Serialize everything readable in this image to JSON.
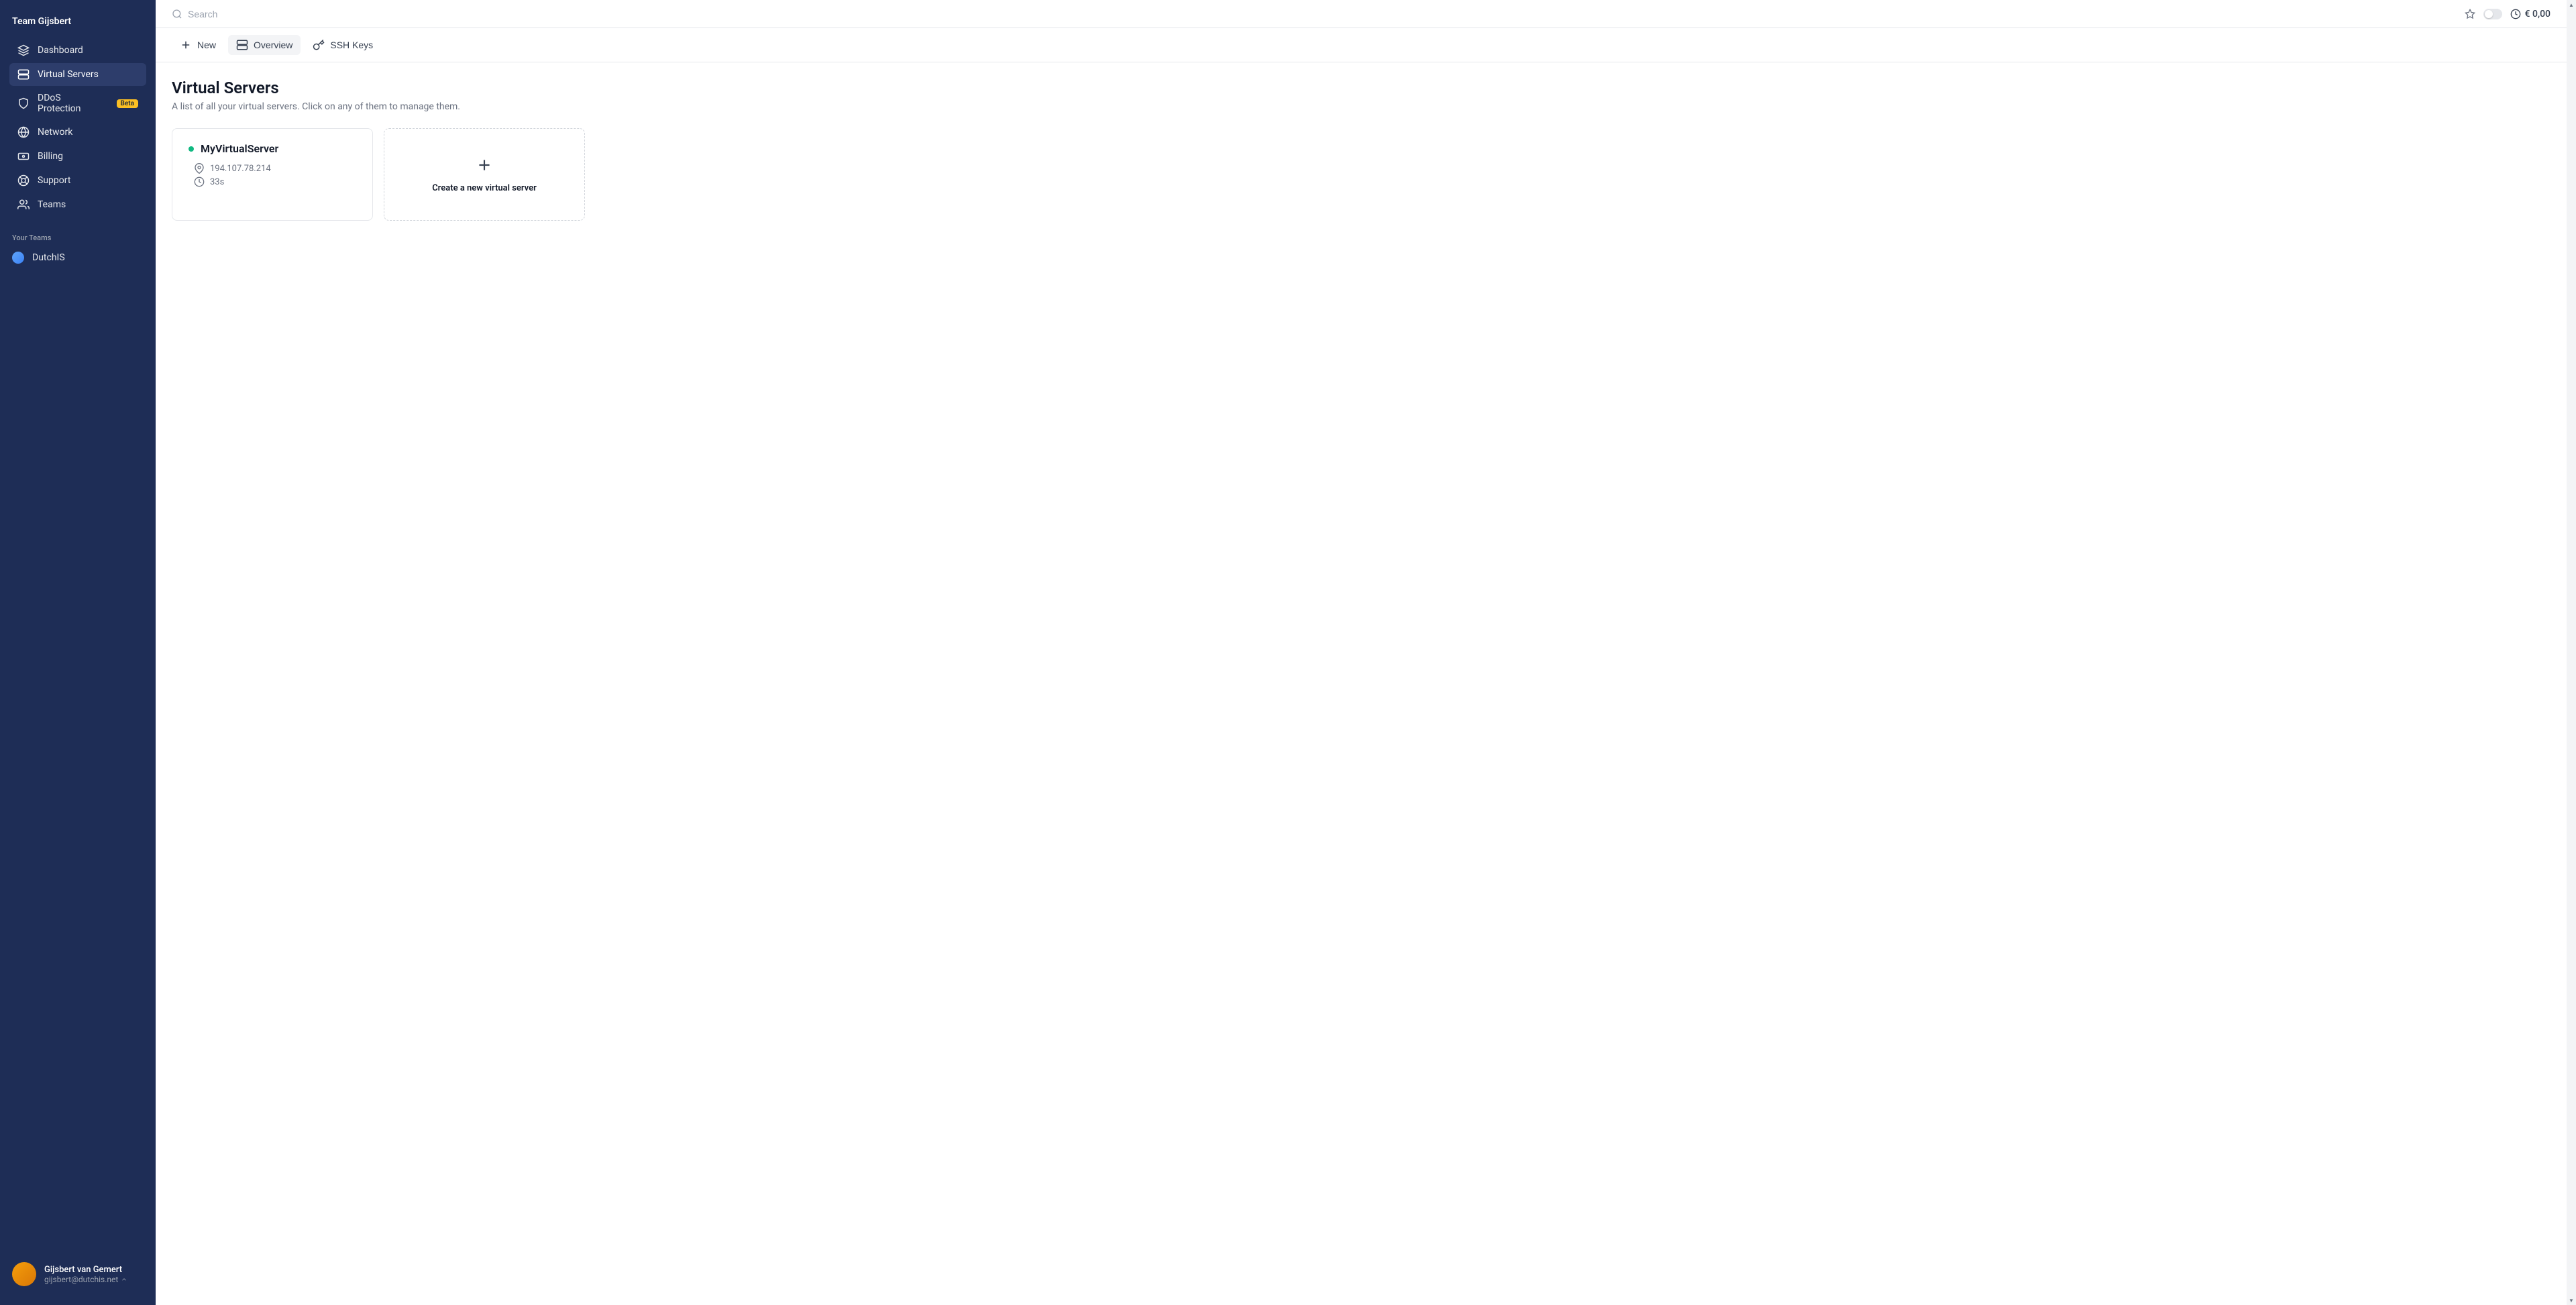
{
  "sidebar": {
    "team_header": "Team Gijsbert",
    "nav": [
      {
        "label": "Dashboard"
      },
      {
        "label": "Virtual Servers"
      },
      {
        "label": "DDoS Protection",
        "badge": "Beta"
      },
      {
        "label": "Network"
      },
      {
        "label": "Billing"
      },
      {
        "label": "Support"
      },
      {
        "label": "Teams"
      }
    ],
    "your_teams_label": "Your Teams",
    "teams": [
      {
        "label": "DutchIS"
      }
    ],
    "user": {
      "name": "Gijsbert van Gemert",
      "email": "gijsbert@dutchis.net"
    }
  },
  "topbar": {
    "search_placeholder": "Search",
    "balance": "€ 0,00"
  },
  "toolbar": {
    "new_label": "New",
    "overview_label": "Overview",
    "ssh_keys_label": "SSH Keys"
  },
  "page": {
    "title": "Virtual Servers",
    "subtitle": "A list of all your virtual servers. Click on any of them to manage them."
  },
  "servers": [
    {
      "name": "MyVirtualServer",
      "ip": "194.107.78.214",
      "uptime": "33s"
    }
  ],
  "create_card": {
    "label": "Create a new virtual server"
  }
}
